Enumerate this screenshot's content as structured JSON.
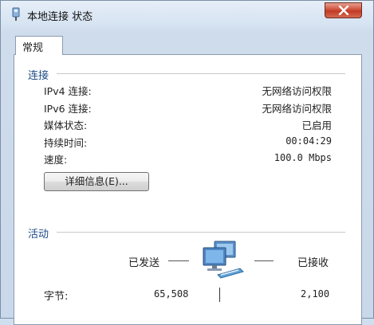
{
  "window": {
    "title": "本地连接 状态"
  },
  "tabs": [
    {
      "label": "常规"
    }
  ],
  "connection": {
    "group_label": "连接",
    "rows": [
      {
        "label": "IPv4 连接:",
        "value": "无网络访问权限"
      },
      {
        "label": "IPv6 连接:",
        "value": "无网络访问权限"
      },
      {
        "label": "媒体状态:",
        "value": "已启用"
      },
      {
        "label": "持续时间:",
        "value": "00:04:29"
      },
      {
        "label": "速度:",
        "value": "100.0 Mbps"
      }
    ],
    "details_button": "详细信息(E)..."
  },
  "activity": {
    "group_label": "活动",
    "sent_label": "已发送",
    "received_label": "已接收",
    "bytes_label": "字节:",
    "bytes_sent": "65,508",
    "bytes_received": "2,100"
  },
  "icons": {
    "title": "network-adapter-icon",
    "close": "close-icon",
    "network": "network-computers-icon"
  },
  "colors": {
    "close_button": "#c13a24",
    "group_label": "#1d4b86"
  }
}
